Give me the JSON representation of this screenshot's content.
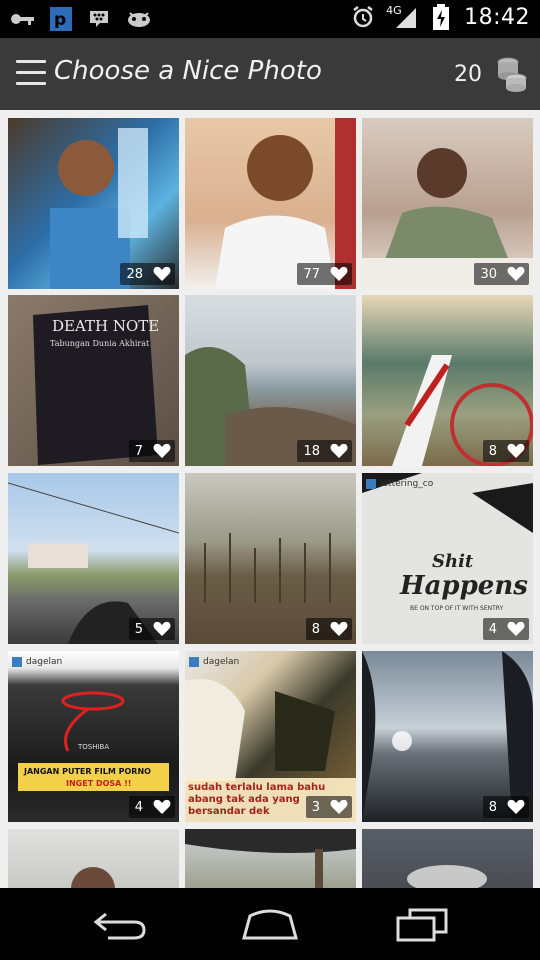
{
  "status": {
    "network": "4G",
    "time": "18:42"
  },
  "appbar": {
    "title": "Choose a Nice Photo",
    "coins": "20"
  },
  "tiles": [
    {
      "likes": "28"
    },
    {
      "likes": "77"
    },
    {
      "likes": "30"
    },
    {
      "likes": "7"
    },
    {
      "likes": "18"
    },
    {
      "likes": "8"
    },
    {
      "likes": "5"
    },
    {
      "likes": "8"
    },
    {
      "likes": "4",
      "tag": "lettering_co"
    },
    {
      "likes": "4",
      "tag": "dagelan"
    },
    {
      "likes": "3",
      "tag": "dagelan",
      "caption": "sudah terlalu lama bahu abang tak ada yang bersandar dek"
    },
    {
      "likes": "8"
    }
  ],
  "overlays": {
    "note_title": "DEATH NOTE",
    "note_sub": "Tabungan Dunia Akhirat",
    "poster_line1": "Shit",
    "poster_line2": "Happens",
    "poster_sub": "BE ON TOP OF IT WITH SENTRY",
    "laptop_label": "TOSHIBA",
    "laptop_msg1": "JANGAN PUTER FILM PORNO",
    "laptop_msg2": "INGET DOSA !!"
  },
  "colors": {
    "appbar": "#3a3a3a",
    "grid_bg": "#efefef"
  }
}
